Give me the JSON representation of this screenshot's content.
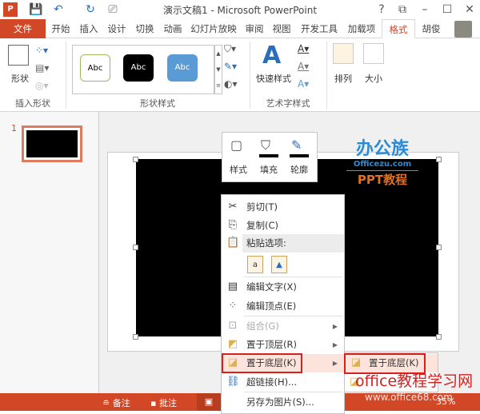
{
  "window": {
    "title": "演示文稿1 - Microsoft PowerPoint",
    "help": "?",
    "restore": "⧉",
    "minimize": "–",
    "maximize": "☐",
    "close": "✕"
  },
  "tabs": [
    {
      "label": "文件"
    },
    {
      "label": "开始"
    },
    {
      "label": "插入"
    },
    {
      "label": "设计"
    },
    {
      "label": "切换"
    },
    {
      "label": "动画"
    },
    {
      "label": "幻灯片放映"
    },
    {
      "label": "审阅"
    },
    {
      "label": "视图"
    },
    {
      "label": "开发工具"
    },
    {
      "label": "加载项"
    },
    {
      "label": "格式"
    }
  ],
  "user": {
    "name": "胡俊"
  },
  "ribbon": {
    "insert_shapes": {
      "shapes_label": "形状",
      "group": "插入形状"
    },
    "shape_styles": {
      "samples": [
        "Abc",
        "Abc",
        "Abc"
      ],
      "group": "形状样式"
    },
    "wordart": {
      "quick_styles": "快速样式",
      "group": "艺术字样式"
    },
    "arrange": "排列",
    "size": "大小"
  },
  "slides": [
    {
      "number": "1"
    }
  ],
  "mini_toolbar": {
    "style": "样式",
    "fill": "填充",
    "outline": "轮廓"
  },
  "context_menu": {
    "cut": "剪切(T)",
    "copy": "复制(C)",
    "paste_options": "粘贴选项:",
    "edit_text": "编辑文字(X)",
    "edit_points": "编辑顶点(E)",
    "group": "组合(G)",
    "bring_to_front": "置于顶层(R)",
    "send_to_back": "置于底层(K)",
    "hyperlink": "超链接(H)...",
    "save_as_picture": "另存为图片(S)..."
  },
  "submenu": {
    "send_to_back": "置于底层(K)"
  },
  "status": {
    "notes": "备注",
    "comments": "批注",
    "zoom": "35%"
  },
  "watermarks": {
    "logo_cn": "办公族",
    "logo_url": "Officezu.com",
    "logo_sub": "PPT教程",
    "site_cn": "office教程学习网",
    "site_url": "www.office68.com"
  },
  "colors": {
    "accent": "#D24726",
    "highlight_box": "#d8201f"
  }
}
